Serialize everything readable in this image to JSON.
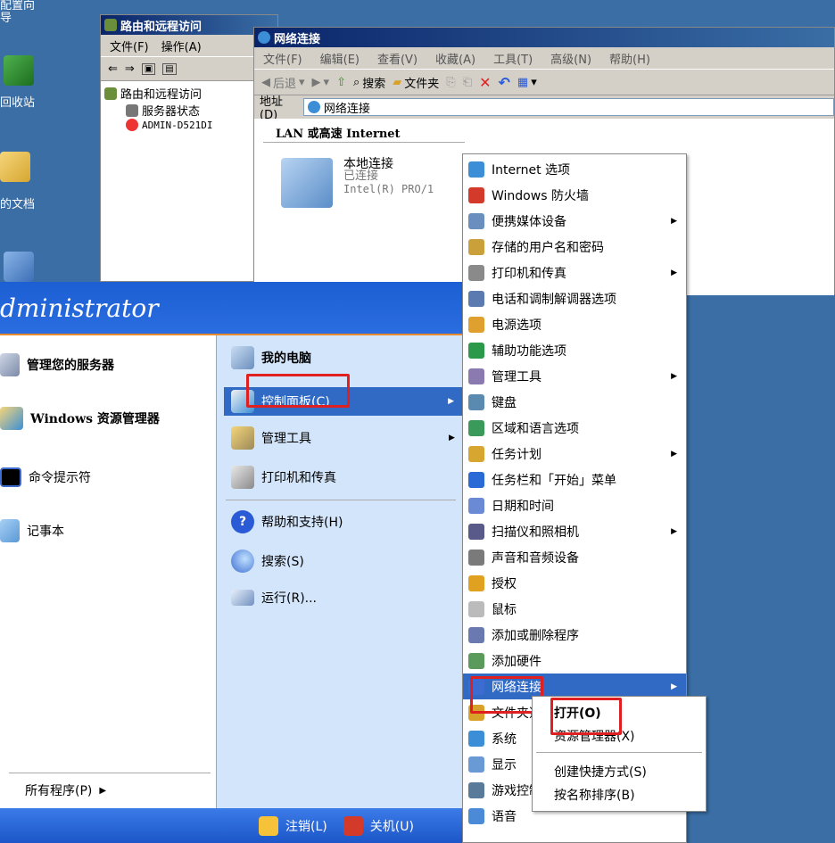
{
  "desktop": {
    "items": [
      {
        "label": "配置向\n导"
      },
      {
        "label": "回收站"
      },
      {
        "label": "的文档"
      }
    ]
  },
  "rras": {
    "title": "路由和远程访问",
    "menu": [
      "文件(F)",
      "操作(A)"
    ],
    "tree": [
      "路由和远程访问",
      "服务器状态",
      "ADMIN-D521DI"
    ]
  },
  "netconn": {
    "title": "网络连接",
    "menu": [
      "文件(F)",
      "编辑(E)",
      "查看(V)",
      "收藏(A)",
      "工具(T)",
      "高级(N)",
      "帮助(H)"
    ],
    "toolbar": {
      "back": "后退",
      "search": "搜索",
      "folders": "文件夹"
    },
    "address_label": "地址(D)",
    "address_value": "网络连接",
    "section": "LAN 或高速 Internet",
    "conn_name": "本地连接",
    "conn_status": "已连接",
    "conn_device": "Intel(R) PRO/1"
  },
  "start_menu": {
    "user": "dministrator",
    "left_items": [
      "管理您的服务器",
      "Windows 资源管理器",
      "命令提示符",
      "记事本"
    ],
    "all_programs": "所有程序(P)",
    "right_items": [
      "我的电脑",
      "控制面板(C)",
      "管理工具",
      "打印机和传真",
      "帮助和支持(H)",
      "搜索(S)",
      "运行(R)..."
    ],
    "logoff": "注销(L)",
    "shutdown": "关机(U)"
  },
  "control_panel": {
    "items": [
      {
        "label": "Internet 选项",
        "arrow": false
      },
      {
        "label": "Windows 防火墙",
        "arrow": false
      },
      {
        "label": "便携媒体设备",
        "arrow": true
      },
      {
        "label": "存储的用户名和密码",
        "arrow": false
      },
      {
        "label": "打印机和传真",
        "arrow": true
      },
      {
        "label": "电话和调制解调器选项",
        "arrow": false
      },
      {
        "label": "电源选项",
        "arrow": false
      },
      {
        "label": "辅助功能选项",
        "arrow": false
      },
      {
        "label": "管理工具",
        "arrow": true
      },
      {
        "label": "键盘",
        "arrow": false
      },
      {
        "label": "区域和语言选项",
        "arrow": false
      },
      {
        "label": "任务计划",
        "arrow": true
      },
      {
        "label": "任务栏和「开始」菜单",
        "arrow": false
      },
      {
        "label": "日期和时间",
        "arrow": false
      },
      {
        "label": "扫描仪和照相机",
        "arrow": true
      },
      {
        "label": "声音和音频设备",
        "arrow": false
      },
      {
        "label": "授权",
        "arrow": false
      },
      {
        "label": "鼠标",
        "arrow": false
      },
      {
        "label": "添加或删除程序",
        "arrow": false
      },
      {
        "label": "添加硬件",
        "arrow": false
      },
      {
        "label": "网络连接",
        "arrow": true
      },
      {
        "label": "文件夹选项",
        "arrow": false
      },
      {
        "label": "系统",
        "arrow": false
      },
      {
        "label": "显示",
        "arrow": false
      },
      {
        "label": "游戏控制器",
        "arrow": false
      },
      {
        "label": "语音",
        "arrow": false
      }
    ]
  },
  "context_menu": {
    "items": [
      "打开(O)",
      "资源管理器(X)",
      "创建快捷方式(S)",
      "按名称排序(B)"
    ]
  },
  "colors": {
    "highlight": "#e02020",
    "selection": "#316ac5"
  }
}
